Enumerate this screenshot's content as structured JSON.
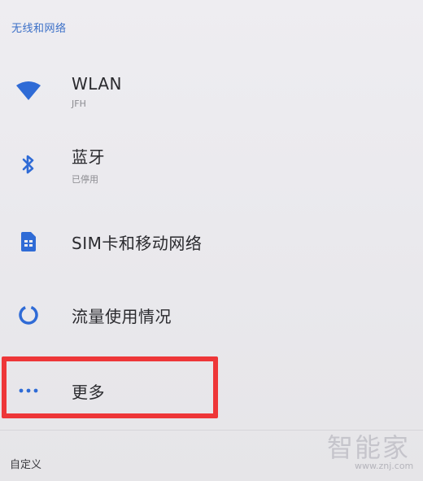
{
  "section": {
    "title": "无线和网络"
  },
  "items": [
    {
      "title": "WLAN",
      "subtitle": "JFH",
      "icon": "wifi-icon"
    },
    {
      "title": "蓝牙",
      "subtitle": "已停用",
      "icon": "bluetooth-icon"
    },
    {
      "title": "SIM卡和移动网络",
      "icon": "sim-card-icon"
    },
    {
      "title": "流量使用情况",
      "icon": "data-usage-icon"
    },
    {
      "title": "更多",
      "icon": "more-icon"
    }
  ],
  "footer": {
    "label": "自定义"
  },
  "watermark": {
    "text": "智能家",
    "url": "www.znj.com"
  },
  "colors": {
    "accent": "#3b6fc7",
    "highlight": "#ee3638"
  }
}
